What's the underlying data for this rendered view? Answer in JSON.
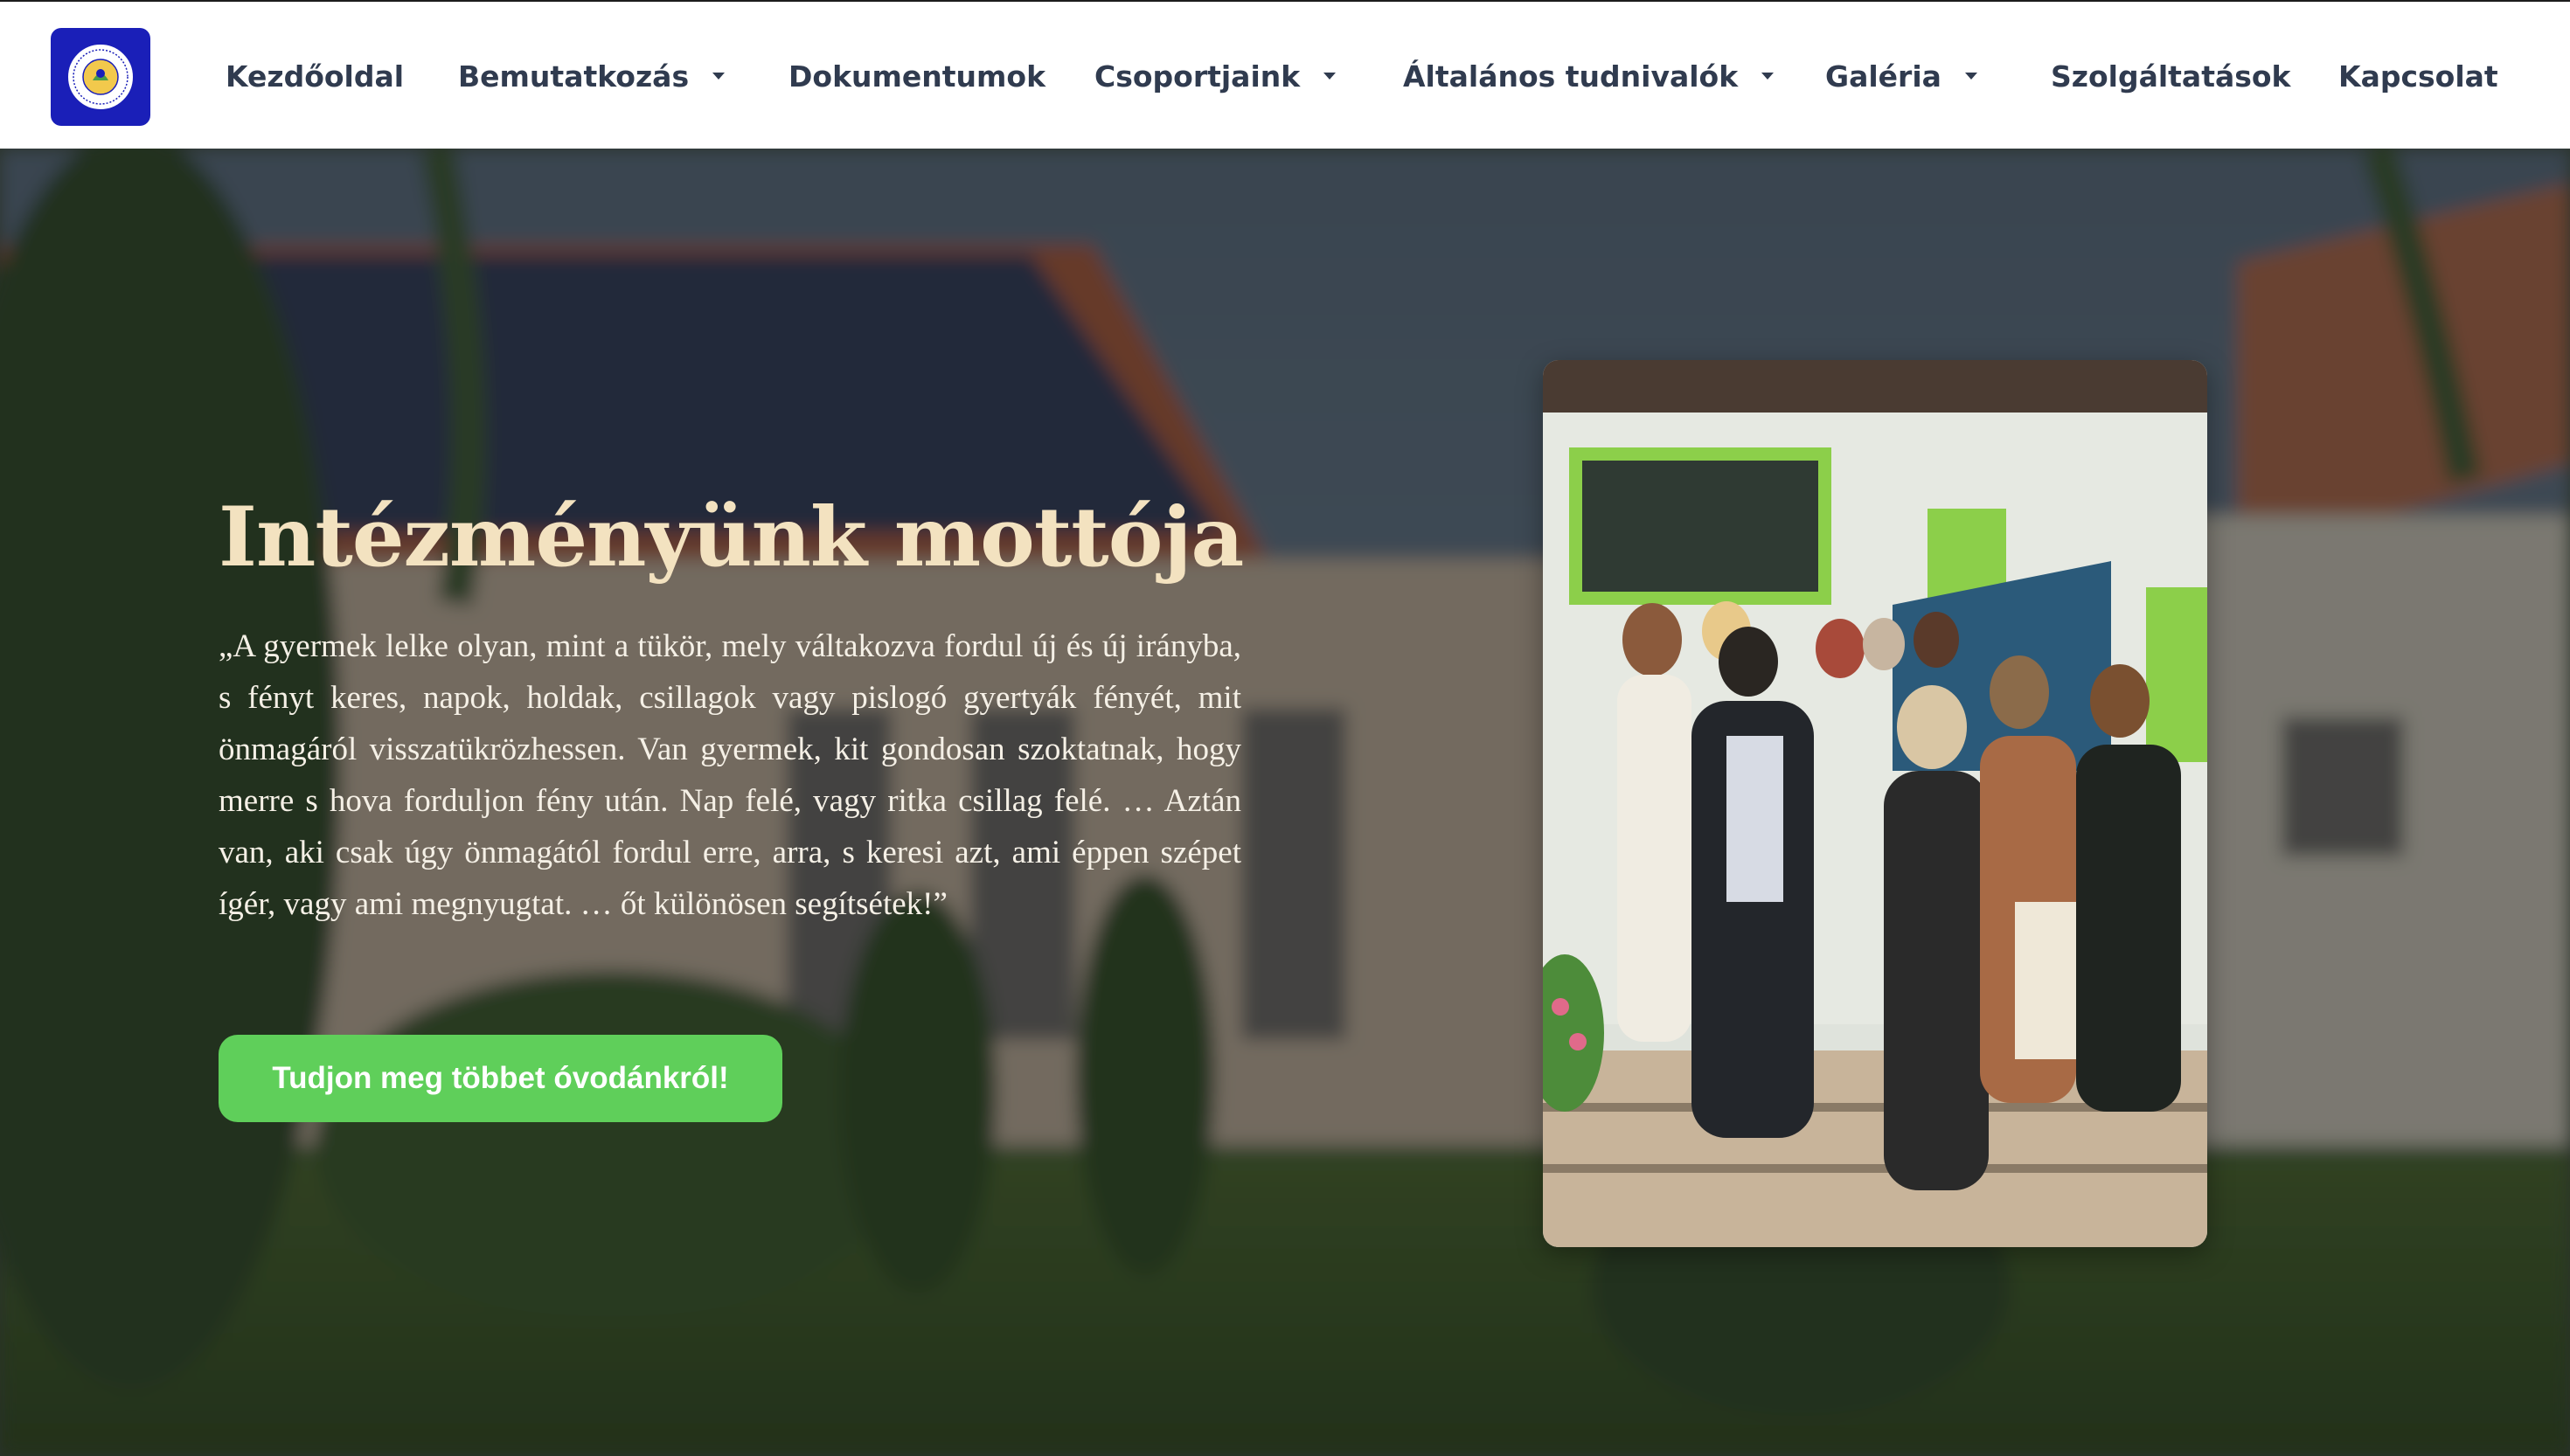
{
  "brand": {
    "logo_icon": "kindergarten-emblem-icon",
    "colors": {
      "logo_bg": "#1a1fb8",
      "accent": "#5fcf5a",
      "title": "#f3e2c0",
      "nav_text": "#303b4f"
    }
  },
  "nav": {
    "items": [
      {
        "label": "Kezdőoldal",
        "has_dropdown": false
      },
      {
        "label": "Bemutatkozás",
        "has_dropdown": true
      },
      {
        "label": "Dokumentumok",
        "has_dropdown": false
      },
      {
        "label": "Csoportjaink",
        "has_dropdown": true
      },
      {
        "label": "Általános tudnivalók",
        "has_dropdown": true
      },
      {
        "label": "Galéria",
        "has_dropdown": true
      },
      {
        "label": "Szolgáltatások",
        "has_dropdown": false
      },
      {
        "label": "Kapcsolat",
        "has_dropdown": false
      }
    ]
  },
  "hero": {
    "title": "Intézményünk mottója",
    "quote": "„A gyermek lelke olyan, mint a tükör, mely váltakozva fordul új és új irányba, s fényt keres, napok, holdak, csillagok vagy pislogó gyertyák fényét, mit önmagáról visszatükrözhessen. Van gyermek, kit gondosan szoktatnak, hogy merre s hova forduljon fény után. Nap felé, vagy ritka csillag felé. … Aztán van, aki csak úgy önmagától fordul erre, arra, s keresi azt, ami éppen szépet ígér, vagy ami megnyugtat. … őt különösen segítsétek!”",
    "cta_label": "Tudjon meg többet óvodánkról!",
    "background_icon": "kindergarten-building-photo",
    "photo_icon": "staff-group-photo"
  }
}
